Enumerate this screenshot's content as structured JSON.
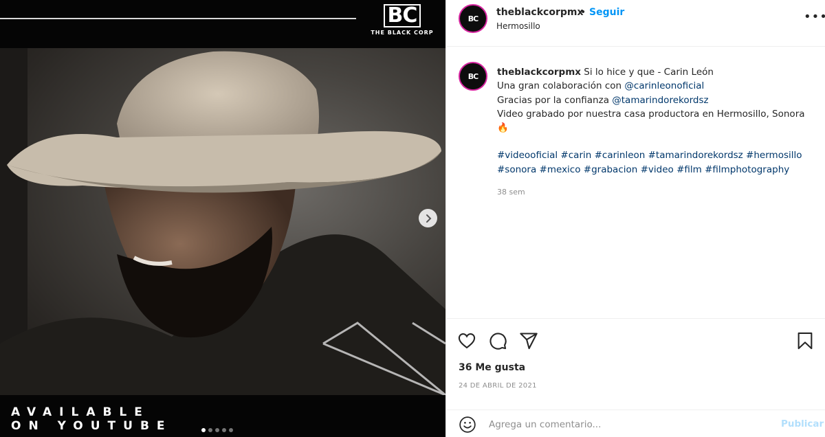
{
  "media": {
    "brand_mark": "BC",
    "brand_name": "THE BLACK CORP",
    "banner_line1": "AVAILABLE",
    "banner_line2": "ON YOUTUBE",
    "carousel_total": 5,
    "carousel_active": 1,
    "icons": {
      "next": "chevron-right-icon"
    }
  },
  "post": {
    "username": "theblackcorpmx",
    "separator": "•",
    "follow_label": "Seguir",
    "location": "Hermosillo",
    "more_label": "•••",
    "caption": {
      "title": "Si lo hice y que - Carin León",
      "line2_prefix": "Una gran colaboración con ",
      "line2_mention": "@carinleonoficial",
      "line3_prefix": "Gracias por la confianza ",
      "line3_mention": "@tamarindorekordsz",
      "line4": "Video grabado por nuestra casa productora en Hermosillo, Sonora",
      "emoji": "🔥",
      "hashtags_line1": "#videooficial #carin #carinleon #tamarindorekordsz #hermosillo",
      "hashtags_line2": "#sonora #mexico #grabacion #video #film #filmphotography"
    },
    "time_ago": "38 sem",
    "likes": "36 Me gusta",
    "date": "24 DE ABRIL DE 2021",
    "comment_placeholder": "Agrega un comentario...",
    "publish_label": "Publicar",
    "icons": {
      "like": "heart-icon",
      "comment": "comment-icon",
      "share": "send-icon",
      "save": "bookmark-icon",
      "emoji": "smiley-icon"
    },
    "colors": {
      "link": "#00376b",
      "follow": "#0095f6",
      "publish_disabled": "#b2dffc",
      "story_ring": "#d6249f"
    }
  }
}
